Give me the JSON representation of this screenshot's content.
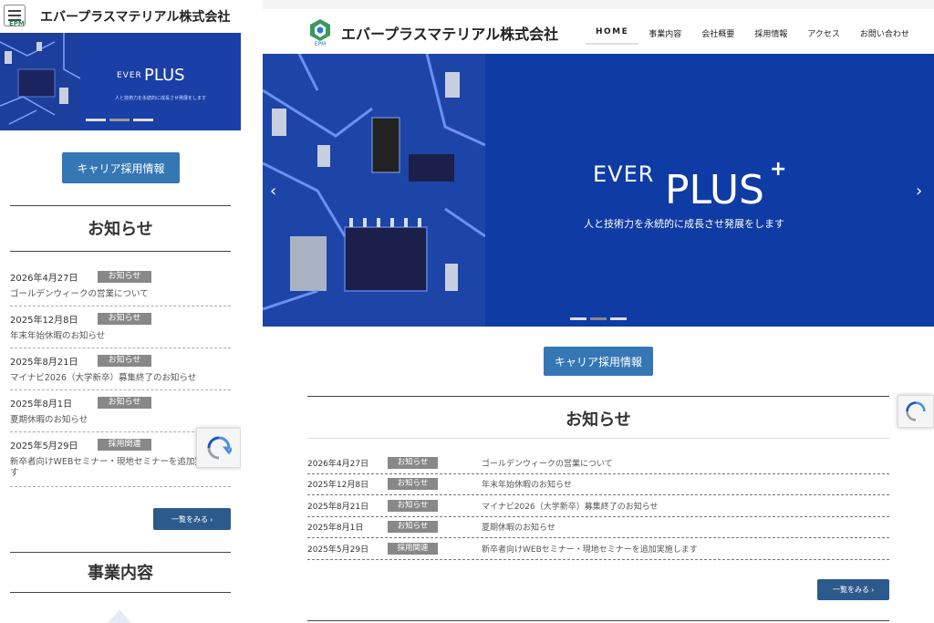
{
  "company_name": "エバープラスマテリアル株式会社",
  "logo_text": "EPM",
  "nav": {
    "items": [
      {
        "label": "HOME"
      },
      {
        "label": "事業内容"
      },
      {
        "label": "会社概要"
      },
      {
        "label": "採用情報"
      },
      {
        "label": "アクセス"
      },
      {
        "label": "お問い合わせ"
      }
    ]
  },
  "hero": {
    "brand_ever": "EVER",
    "brand_plus": "PLUS",
    "plus_sign": "+",
    "tagline": "人と技術力を永続的に成長させ発展をします",
    "prev_arrow": "‹",
    "next_arrow": "›"
  },
  "career_button": "キャリア採用情報",
  "news_section": {
    "title": "お知らせ",
    "more_label": "一覧をみる ›",
    "items": [
      {
        "date": "2026年4月27日",
        "category": "お知らせ",
        "title": "ゴールデンウィークの営業について"
      },
      {
        "date": "2025年12月8日",
        "category": "お知らせ",
        "title": "年末年始休暇のお知らせ"
      },
      {
        "date": "2025年8月21日",
        "category": "お知らせ",
        "title": "マイナビ2026（大学新卒）募集終了のお知らせ"
      },
      {
        "date": "2025年8月1日",
        "category": "お知らせ",
        "title": "夏期休暇のお知らせ"
      },
      {
        "date": "2025年5月29日",
        "category": "採用関連",
        "title": "新卒者向けWEBセミナー・現地セミナーを追加実施します"
      }
    ]
  },
  "business_section": {
    "title": "事業内容"
  },
  "colors": {
    "hero_blue": "#0f3ba5",
    "button_blue": "#3577b5",
    "badge_gray": "#888888"
  }
}
